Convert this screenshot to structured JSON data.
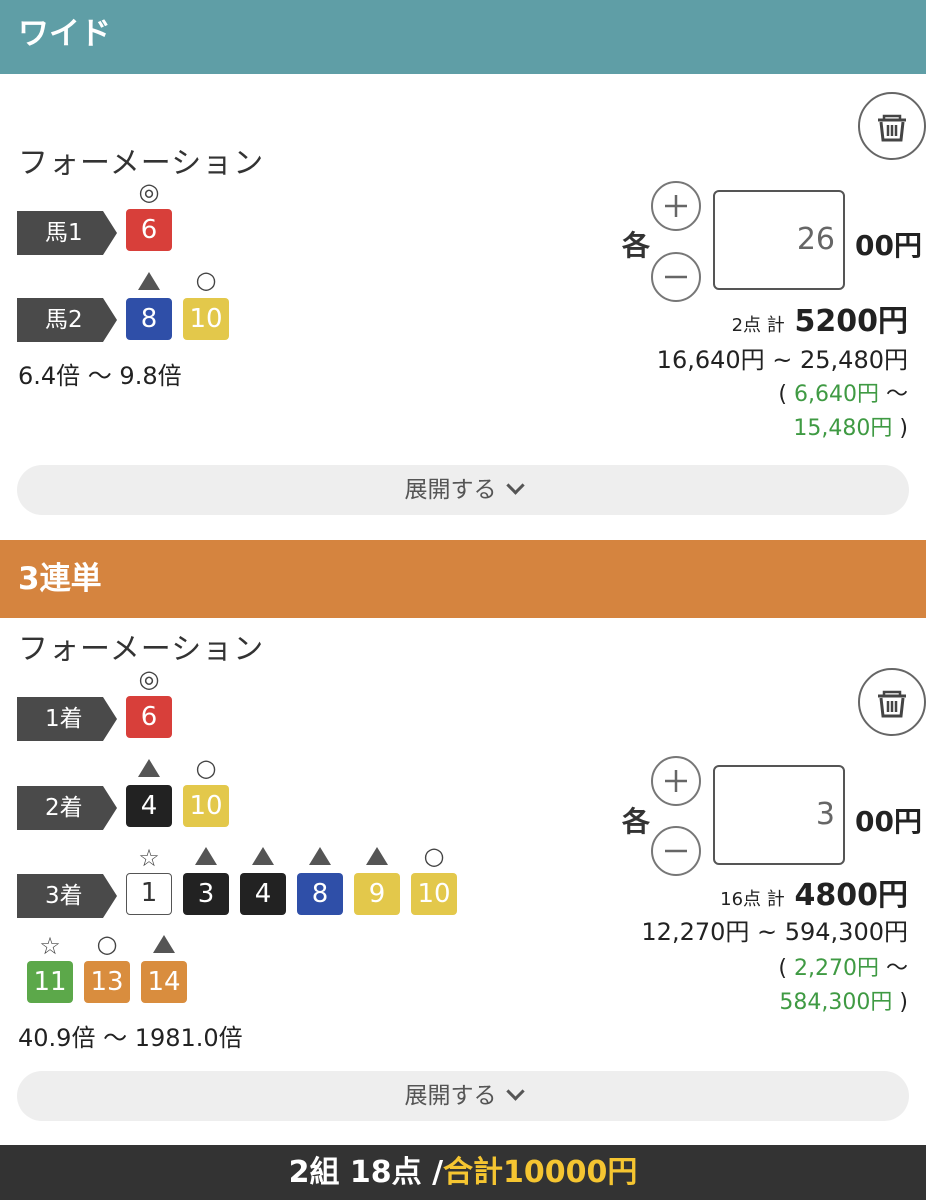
{
  "wide": {
    "header": "ワイド",
    "type": "フォーメーション",
    "rows": [
      {
        "label": "馬1",
        "horses": [
          {
            "num": "6",
            "color": "red",
            "mark": "◎"
          }
        ]
      },
      {
        "label": "馬2",
        "horses": [
          {
            "num": "8",
            "color": "blue",
            "mark": "▲"
          },
          {
            "num": "10",
            "color": "yellow",
            "mark": "○"
          }
        ]
      }
    ],
    "odds": "6.4倍 〜 9.8倍",
    "each_label": "各",
    "amount": "26",
    "unit": "00円",
    "points_count": "2点",
    "points_kei": "計",
    "points_total": "5200円",
    "payout_range": "16,640円 ~ 25,480円",
    "profit_open": "(",
    "profit_min": "6,640円",
    "profit_tilde": "〜",
    "profit_max": "15,480円",
    "profit_close": ")",
    "expand_label": "展開する"
  },
  "trifecta": {
    "header": "3連単",
    "type": "フォーメーション",
    "rows": [
      {
        "label": "1着",
        "horses": [
          {
            "num": "6",
            "color": "red",
            "mark": "◎"
          }
        ]
      },
      {
        "label": "2着",
        "horses": [
          {
            "num": "4",
            "color": "black",
            "mark": "▲"
          },
          {
            "num": "10",
            "color": "yellow",
            "mark": "○"
          }
        ]
      },
      {
        "label": "3着",
        "horses": [
          {
            "num": "1",
            "color": "white",
            "mark": "☆"
          },
          {
            "num": "3",
            "color": "black",
            "mark": "▲"
          },
          {
            "num": "4",
            "color": "black",
            "mark": "▲"
          },
          {
            "num": "8",
            "color": "blue",
            "mark": "▲"
          },
          {
            "num": "9",
            "color": "yellow",
            "mark": "▲"
          },
          {
            "num": "10",
            "color": "yellow",
            "mark": "○"
          },
          {
            "num": "11",
            "color": "green",
            "mark": "☆"
          },
          {
            "num": "13",
            "color": "orange",
            "mark": "○"
          },
          {
            "num": "14",
            "color": "orange",
            "mark": "▲"
          }
        ]
      }
    ],
    "odds": "40.9倍 〜 1981.0倍",
    "each_label": "各",
    "amount": "3",
    "unit": "00円",
    "points_count": "16点",
    "points_kei": "計",
    "points_total": "4800円",
    "payout_range": "12,270円 ~ 594,300円",
    "profit_open": "(",
    "profit_min": "2,270円",
    "profit_tilde": "〜",
    "profit_max": "584,300円",
    "profit_close": ")",
    "expand_label": "展開する"
  },
  "footer": {
    "summary": "2組 18点 /",
    "total": "合計10000円"
  },
  "colors": {
    "wide_header": "#5f9ea6",
    "trifecta_header": "#d5843f",
    "profit_green": "#3f9a43",
    "footer_total": "#f5c531"
  }
}
